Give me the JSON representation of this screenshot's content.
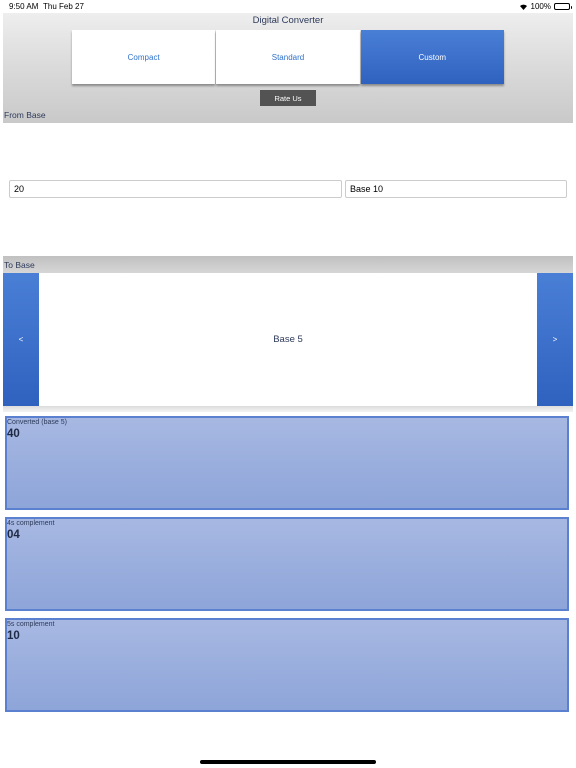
{
  "status_bar": {
    "time": "9:50 AM",
    "date": "Thu Feb 27",
    "battery": "100%"
  },
  "app": {
    "title": "Digital Converter"
  },
  "segments": [
    {
      "label": "Compact",
      "selected": false
    },
    {
      "label": "Standard",
      "selected": false
    },
    {
      "label": "Custom",
      "selected": true
    }
  ],
  "rate_button": "Rate Us",
  "from_base": {
    "label": "From Base",
    "number_value": "20",
    "base_value": "Base 10"
  },
  "to_base": {
    "label": "To Base",
    "prev": "<",
    "next": ">",
    "selected": "Base 5"
  },
  "results": [
    {
      "caption": "Converted (base 5)",
      "value": "40"
    },
    {
      "caption": "4s complement",
      "value": "04"
    },
    {
      "caption": "5s complement",
      "value": "10"
    }
  ],
  "colors": {
    "accent": "#3a6fcf",
    "result_fill": "#9bb0df",
    "result_border": "#5a80cf",
    "button_dark": "#535353"
  }
}
